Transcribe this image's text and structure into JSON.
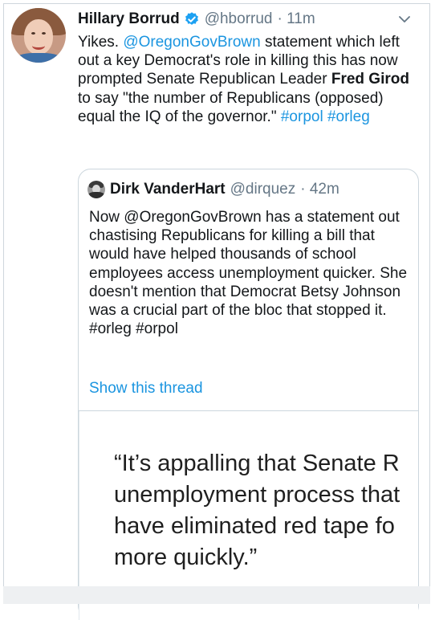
{
  "tweet": {
    "author_name": "Hillary Borrud",
    "handle": "@hborrud",
    "time": "· 11m",
    "avatar_icon": "profile-photo",
    "text_parts": {
      "p1": "Yikes. ",
      "mention1": "@OregonGovBrown",
      "p2": " statement which left out a key Democrat's role in killing this has now prompted Senate Republican Leader ",
      "bold_name": "Fred Girod",
      "p3": " to say \"the number of Republicans (opposed) equal the IQ of the governor.\" ",
      "tag1": "#orpol",
      "space": " ",
      "tag2": "#orleg"
    }
  },
  "quoted": {
    "author_name": "Dirk VanderHart",
    "handle": "@dirquez",
    "time": "· 42m",
    "text": "Now @OregonGovBrown  has a statement out chastising Republicans for killing a bill that would have helped thousands of school employees access unemployment quicker. She doesn't mention that Democrat Betsy Johnson was a crucial part of the bloc that stopped it. #orleg #orpol",
    "show_thread": "Show this thread",
    "media_lines": [
      "“It’s appalling that Senate R",
      "unemployment process that",
      "have eliminated red tape fo",
      "more quickly.”"
    ]
  },
  "colors": {
    "link": "#1b95e0",
    "handle_gray": "#657786",
    "verified_blue": "#1da1f2"
  }
}
